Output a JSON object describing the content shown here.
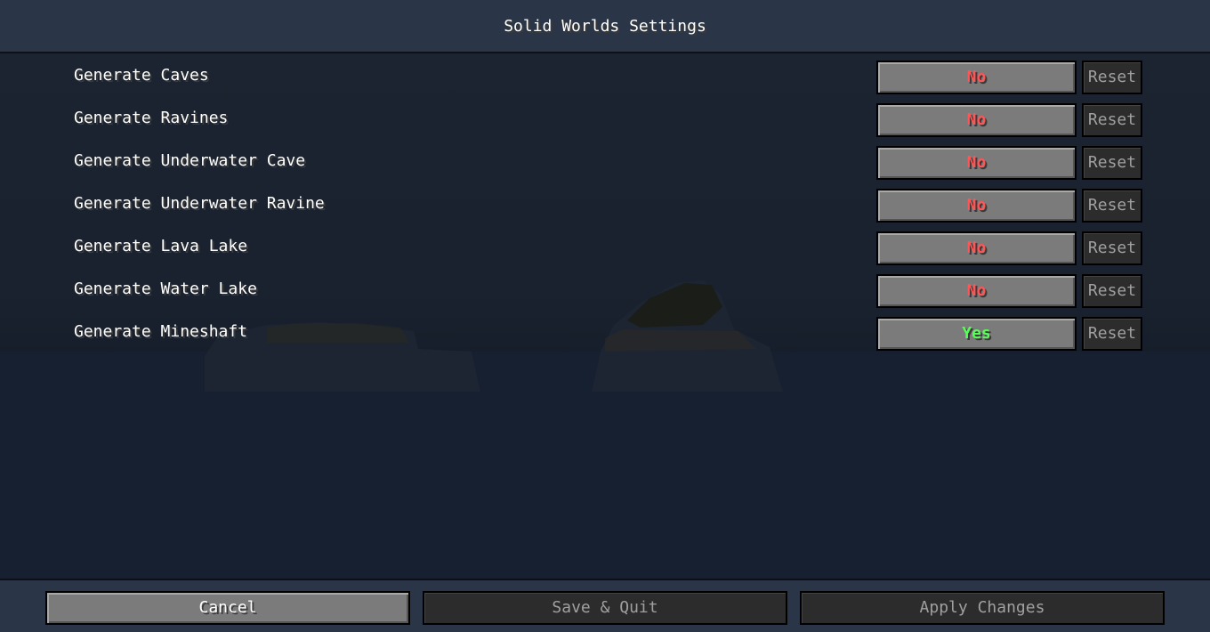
{
  "header": {
    "title": "Solid Worlds Settings"
  },
  "settings": [
    {
      "label": "Generate Caves",
      "value": "No",
      "reset": "Reset"
    },
    {
      "label": "Generate Ravines",
      "value": "No",
      "reset": "Reset"
    },
    {
      "label": "Generate Underwater Cave",
      "value": "No",
      "reset": "Reset"
    },
    {
      "label": "Generate Underwater Ravine",
      "value": "No",
      "reset": "Reset"
    },
    {
      "label": "Generate Lava Lake",
      "value": "No",
      "reset": "Reset"
    },
    {
      "label": "Generate Water Lake",
      "value": "No",
      "reset": "Reset"
    },
    {
      "label": "Generate Mineshaft",
      "value": "Yes",
      "reset": "Reset"
    }
  ],
  "footer": {
    "cancel": "Cancel",
    "save_quit": "Save & Quit",
    "apply": "Apply Changes"
  },
  "colors": {
    "no": "#ff5555",
    "yes": "#55ff55"
  }
}
